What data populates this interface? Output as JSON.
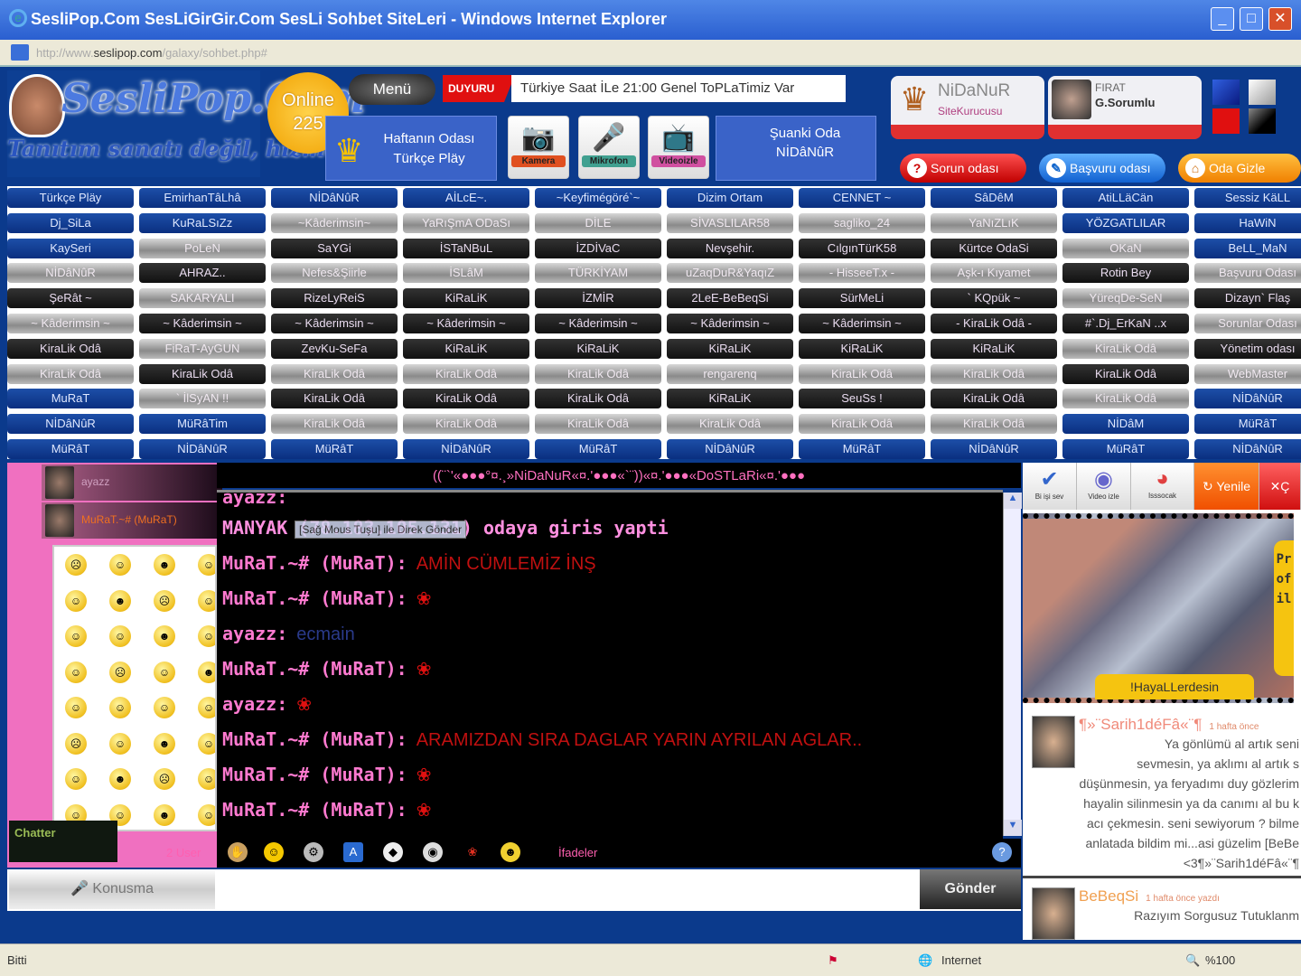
{
  "window": {
    "title": "SesliPop.Com SesLiGirGir.Com SesLi Sohbet SiteLeri - Windows Internet Explorer",
    "minimize": "_",
    "maximize": "□",
    "close": "✕"
  },
  "address": {
    "prefix": "http://www.",
    "domain": "seslipop.com",
    "path": "/galaxy/sohbet.php#"
  },
  "header": {
    "logo": "SesliPop.Com",
    "slogan": "Tanıtım sanatı değil, hizmeti sohbet",
    "online_label": "Online",
    "online_count": "225",
    "menu": "Menü",
    "duyuru": "DUYURU",
    "ticker": "Türkiye Saat İLe 21:00 Genel ToPLaTimiz Var",
    "week_room_label": "Haftanın Odası",
    "week_room": "Türkçe Pläy",
    "media": [
      {
        "label": "Kamera",
        "icon": "📷",
        "color": "#e05020"
      },
      {
        "label": "Mikrofon",
        "icon": "🎤",
        "color": "#40a090"
      },
      {
        "label": "Videoizle",
        "icon": "📺",
        "color": "#d050a0"
      }
    ],
    "current_room_label": "Şuanki Oda",
    "current_room": "NİDâNûR",
    "admins": [
      {
        "name": "NiDaNuR",
        "role": "SiteKurucusu"
      },
      {
        "name": "FIRAT",
        "role": "G.Sorumlu"
      }
    ],
    "themes": [
      "#1a3fc0",
      "#d8d8d8",
      "#e01010",
      "#111111"
    ],
    "pills": [
      {
        "label": "Sorun odası",
        "color": "#e02020",
        "icon": "?"
      },
      {
        "label": "Başvuru odası",
        "color": "#2a8ae0",
        "icon": "✎"
      },
      {
        "label": "Oda Gizle",
        "color": "#f59010",
        "icon": "⌂"
      }
    ]
  },
  "rooms": [
    [
      [
        "Türkçe Pläy",
        "b"
      ],
      [
        "EmirhanTâLhâ",
        "b"
      ],
      [
        "NİDâNûR",
        "b"
      ],
      [
        "AİLcE~.",
        "b"
      ],
      [
        "~Keyfimégöré`~",
        "b"
      ],
      [
        "Dizim Ortam",
        "b"
      ],
      [
        "CENNET ~",
        "b"
      ],
      [
        "SâDêM",
        "b"
      ],
      [
        "AtiLLäCän",
        "b"
      ],
      [
        "Sessiz KäLL",
        "b"
      ]
    ],
    [
      [
        "Dj_SiLa",
        "b"
      ],
      [
        "KuRaLSıZz",
        "b"
      ],
      [
        "~Kâderimsin~",
        "g"
      ],
      [
        "YaRıŞmA ODaSı",
        "g"
      ],
      [
        "DİLE",
        "g"
      ],
      [
        "SİVASLILAR58",
        "g"
      ],
      [
        "sagliko_24",
        "g"
      ],
      [
        "YaNıZLıK",
        "g"
      ],
      [
        "YÖZGATLILAR",
        "b"
      ],
      [
        "HaWiN",
        "b"
      ]
    ],
    [
      [
        "KaySeri",
        "b"
      ],
      [
        "PoLeN",
        "g"
      ],
      [
        "SaYGi",
        "k"
      ],
      [
        "İSTaNBuL",
        "k"
      ],
      [
        "İZDİVaC",
        "k"
      ],
      [
        "Nevşehir.",
        "k"
      ],
      [
        "CılgınTürK58",
        "k"
      ],
      [
        "Kürtce OdaSi",
        "k"
      ],
      [
        "OKaN",
        "g"
      ],
      [
        "BeLL_MaN",
        "b"
      ]
    ],
    [
      [
        "NİDâNûR",
        "g"
      ],
      [
        "AHRAZ..",
        "k"
      ],
      [
        "Nefes&Şiirle",
        "g"
      ],
      [
        "İSLâM",
        "g"
      ],
      [
        "TÜRKİYAM",
        "g"
      ],
      [
        "uZaqDuR&YaqıZ",
        "g"
      ],
      [
        "- HisseeT.x -",
        "g"
      ],
      [
        "Aşk-ı Kıyamet",
        "g"
      ],
      [
        "Rotin Bey",
        "k"
      ],
      [
        "Başvuru Odası",
        "g"
      ]
    ],
    [
      [
        "ŞeRât ~",
        "k"
      ],
      [
        "SAKARYALI",
        "g"
      ],
      [
        "RizeLyReiS",
        "k"
      ],
      [
        "KiRaLiK",
        "k"
      ],
      [
        "İZMİR",
        "k"
      ],
      [
        "2LeE-BeBeqSi",
        "k"
      ],
      [
        "SürMeLi",
        "k"
      ],
      [
        "` KQpük ~",
        "k"
      ],
      [
        "YüreqDe-SeN",
        "g"
      ],
      [
        "Dizayn` Flaş",
        "k"
      ]
    ],
    [
      [
        "~ Kâderimsin ~",
        "g"
      ],
      [
        "~ Kâderimsin ~",
        "k"
      ],
      [
        "~ Kâderimsin ~",
        "k"
      ],
      [
        "~ Kâderimsin ~",
        "k"
      ],
      [
        "~ Kâderimsin ~",
        "k"
      ],
      [
        "~ Kâderimsin ~",
        "k"
      ],
      [
        "~ Kâderimsin ~",
        "k"
      ],
      [
        "- KiraLik Odâ -",
        "k"
      ],
      [
        "#`.Dj_ErKaN ..x",
        "k"
      ],
      [
        "Sorunlar Odası",
        "g"
      ]
    ],
    [
      [
        "KiraLik Odâ",
        "k"
      ],
      [
        "FiRaT-AyGUN",
        "g"
      ],
      [
        "ZevKu-SeFa",
        "k"
      ],
      [
        "KiRaLiK",
        "k"
      ],
      [
        "KiRaLiK",
        "k"
      ],
      [
        "KiRaLiK",
        "k"
      ],
      [
        "KiRaLiK",
        "k"
      ],
      [
        "KiRaLiK",
        "k"
      ],
      [
        "KiraLik Odâ",
        "g"
      ],
      [
        "Yönetim odası",
        "k"
      ]
    ],
    [
      [
        "KiraLik Odâ",
        "g"
      ],
      [
        "KiraLik Odâ",
        "k"
      ],
      [
        "KiraLik Odâ",
        "g"
      ],
      [
        "KiraLik Odâ",
        "g"
      ],
      [
        "KiraLik Odâ",
        "g"
      ],
      [
        "rengarenq",
        "g"
      ],
      [
        "KiraLik Odâ",
        "g"
      ],
      [
        "KiraLik Odâ",
        "g"
      ],
      [
        "KiraLik Odâ",
        "k"
      ],
      [
        "WebMaster",
        "g"
      ]
    ],
    [
      [
        "MuRaT",
        "b"
      ],
      [
        "` İlSyAN !!",
        "g"
      ],
      [
        "KiraLik Odâ",
        "k"
      ],
      [
        "KiraLik Odâ",
        "k"
      ],
      [
        "KiraLik Odâ",
        "k"
      ],
      [
        "KiRaLiK",
        "k"
      ],
      [
        "SeuSs !",
        "k"
      ],
      [
        "KiraLik Odâ",
        "k"
      ],
      [
        "KiraLik Odâ",
        "g"
      ],
      [
        "NİDâNûR",
        "b"
      ]
    ],
    [
      [
        "NİDâNûR",
        "b"
      ],
      [
        "MüRâTim",
        "b"
      ],
      [
        "KiraLik Odâ",
        "g"
      ],
      [
        "KiraLik Odâ",
        "g"
      ],
      [
        "KiraLik Odâ",
        "g"
      ],
      [
        "KiraLik Odâ",
        "g"
      ],
      [
        "KiraLik Odâ",
        "g"
      ],
      [
        "KiraLik Odâ",
        "g"
      ],
      [
        "NİDâM",
        "b"
      ],
      [
        "MüRâT",
        "b"
      ]
    ],
    [
      [
        "MüRâT",
        "b"
      ],
      [
        "NİDâNûR",
        "b"
      ],
      [
        "MüRâT",
        "b"
      ],
      [
        "NİDâNûR",
        "b"
      ],
      [
        "MüRâT",
        "b"
      ],
      [
        "NİDâNûR",
        "b"
      ],
      [
        "MüRâT",
        "b"
      ],
      [
        "NİDâNûR",
        "b"
      ],
      [
        "MüRâT",
        "b"
      ],
      [
        "NİDâNûR",
        "b"
      ]
    ]
  ],
  "chat": {
    "title": "((¨`'«●●●°¤.¸»NiDaNuR«¤.'●●●«`¨))«¤.'●●●«DoSTLaRi«¤.'●●●",
    "users": [
      {
        "name": "ayazz",
        "color": "#d0a0c0"
      },
      {
        "name": "MuRaT.~# (MuRaT)",
        "color": "#f07020"
      }
    ],
    "tooltip": "[Sağ Mous Tuşu] ile Direk Gönder",
    "messages": [
      {
        "from": "ayazz:",
        "text": "",
        "color": "#2a3a8a"
      },
      {
        "from": "MANYAK (78.183.105.131) odaya giris yapti",
        "text": "",
        "sys": true
      },
      {
        "from": "MuRaT.~# (MuRaT):",
        "text": "AMİN CÜMLEMİZ İNŞ",
        "color": "#c01010"
      },
      {
        "from": "MuRaT.~# (MuRaT):",
        "rose": "❀"
      },
      {
        "from": "ayazz:",
        "text": "ecmain",
        "color": "#2a3a8a"
      },
      {
        "from": "MuRaT.~# (MuRaT):",
        "rose": "❀"
      },
      {
        "from": "ayazz:",
        "rose": "❀"
      },
      {
        "from": "MuRaT.~# (MuRaT):",
        "text": "ARAMIZDAN SIRA DAGLAR YARIN AYRILAN AGLAR..",
        "color": "#c01010"
      },
      {
        "from": "MuRaT.~# (MuRaT):",
        "rose": "❀"
      },
      {
        "from": "MuRaT.~# (MuRaT):",
        "rose": "❀"
      }
    ],
    "user_count": "2 User",
    "emoticons_label": "İfadeler",
    "speak_button": "Konusma",
    "input_value": "",
    "send_button": "Gönder",
    "brand": "Chatter"
  },
  "right": {
    "toolbar": [
      {
        "label": "Bi işi sev",
        "icon": "✔"
      },
      {
        "label": "Video izle",
        "icon": "◉"
      },
      {
        "label": "Isssocak",
        "icon": "◕"
      },
      {
        "label": "Yenile",
        "icon": "↻"
      },
      {
        "label": "Ç",
        "icon": "✕"
      }
    ],
    "profile_name": "!HayaLLerdesin",
    "profile_tab": "Profil",
    "posts": [
      {
        "author": "¶»¨Sarih1déFâ«¨¶",
        "time": "1 hafta önce",
        "lines": [
          "Ya gönlümü al artık seni",
          "sevmesin, ya aklımı al artık s",
          "düşünmesin, ya feryadımı duy gözlerim",
          "hayalin silinmesin ya da canımı al bu k",
          "acı çekmesin. seni sewiyorum ? bilme",
          "anlatada bildim mi...asi güzelim [BeBe",
          "<3¶»¨Sarih1déFâ«¨¶"
        ]
      },
      {
        "author": "BeBeqSi",
        "time": "1 hafta önce yazdı",
        "lines": [
          "Razıyım Sorgusuz Tutuklanm"
        ]
      }
    ]
  },
  "status": {
    "left": "Bitti",
    "zone": "Internet",
    "zoom": "%100"
  }
}
